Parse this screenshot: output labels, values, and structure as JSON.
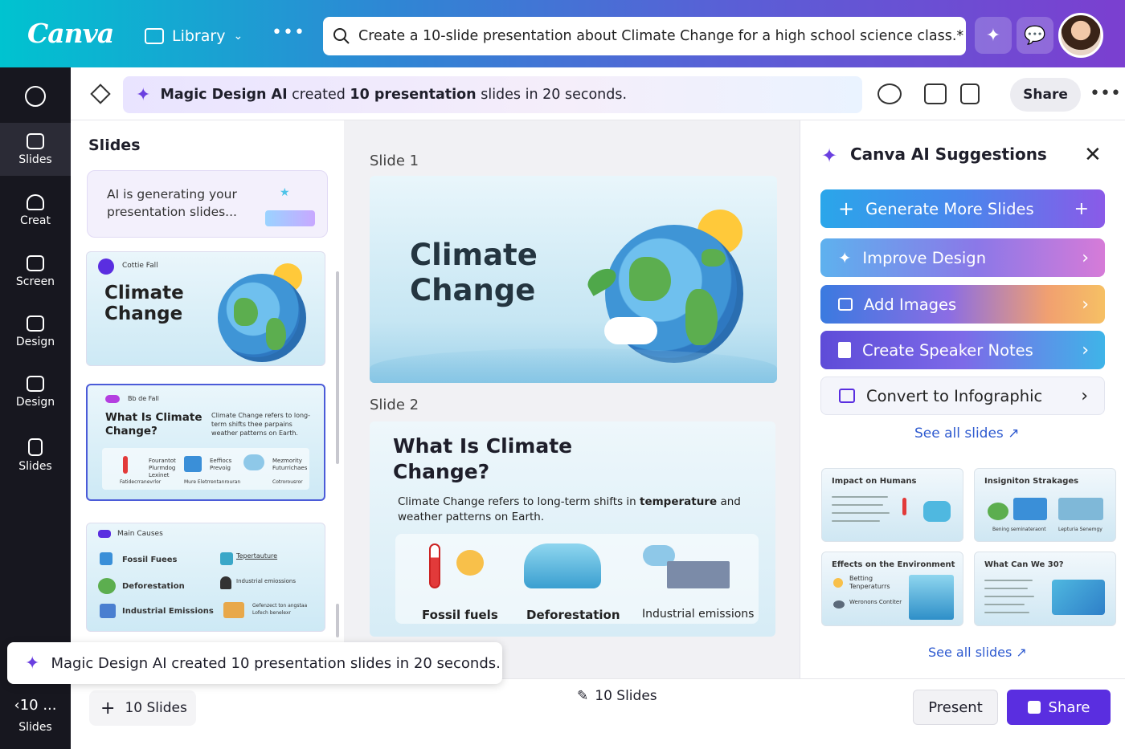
{
  "app": {
    "logo": "Canva",
    "library_label": "Library",
    "search_query": "Create a 10-slide presentation about Climate Change for a high school science class.*"
  },
  "rail": {
    "items": [
      {
        "label": "Slides"
      },
      {
        "label": "Creat"
      },
      {
        "label": "Screen"
      },
      {
        "label": "Design"
      },
      {
        "label": "Design"
      },
      {
        "label": "Slides"
      }
    ],
    "count_number": "‹10 ...",
    "count_label": "Slides"
  },
  "toolbar": {
    "banner_bold1": "Magic Design AI",
    "banner_text1": " created ",
    "banner_bold2": "10 presentation",
    "banner_text2": " slides in 20 seconds.",
    "share_label": "Share"
  },
  "slides_panel": {
    "title": "Slides",
    "generating_text": "AI is generating your presentation slides...",
    "thumbs": [
      {
        "tag": "Cottie Fall",
        "title": "Climate Change"
      },
      {
        "tag": "Bb de Fall",
        "title": "What Is Climate Change?",
        "desc": "Climate Change refers to long-term shifts thee parpains weather patterns on Earth.",
        "items": [
          "Fourantot Plurmdog Lexinet",
          "Eeffiocs Prevoig",
          "Mezmority Futurrichaes"
        ],
        "foot": [
          "Fatidecrranevrlor",
          "Mure Eletrrentanrouran",
          "Cotrorousror"
        ]
      },
      {
        "tag": "Main Causes",
        "items": [
          "Fossil Fuees",
          "Deforestation",
          "Industrial Emissions",
          "Tepertauture",
          "Industrial emiossions",
          "Gefenzect ton angstaa Lofech benelexr"
        ]
      }
    ]
  },
  "canvas": {
    "slide1_label": "Slide 1",
    "slide1_title": "Climate Change",
    "slide2_label": "Slide 2",
    "slide2_title": "What Is Climate Change?",
    "slide2_desc_a": "Climate Change refers to long-term shifts in ",
    "slide2_desc_b": "temperature",
    "slide2_desc_c": " and weather patterns on Earth.",
    "slide2_items": [
      "Fossil fuels",
      "Deforestation",
      "Industrial emissions"
    ]
  },
  "ai_panel": {
    "title": "Canva AI Suggestions",
    "buttons": [
      "Generate More Slides",
      "Improve Design",
      "Add Images",
      "Create Speaker Notes",
      "Convert to Infographic"
    ],
    "see_all_1": "See all slides",
    "see_all_2": "See all slides",
    "suggestions": [
      {
        "title": "Impact on Humans"
      },
      {
        "title": "Insigniton Strakages",
        "caption_a": "Bening seminateraont",
        "caption_b": "Lepturia Senemgy"
      },
      {
        "title": "Effects on the Environment",
        "line_a": "Betting Tenperaturrs",
        "line_b": "Weronons Contiter"
      },
      {
        "title": "What Can We 30?"
      }
    ]
  },
  "toast": {
    "text": "Magic Design AI created 10 presentation slides in 20 seconds."
  },
  "bottom": {
    "add_label": "10 Slides",
    "count_label": "10 Slides",
    "present_label": "Present",
    "share_label": "Share"
  }
}
